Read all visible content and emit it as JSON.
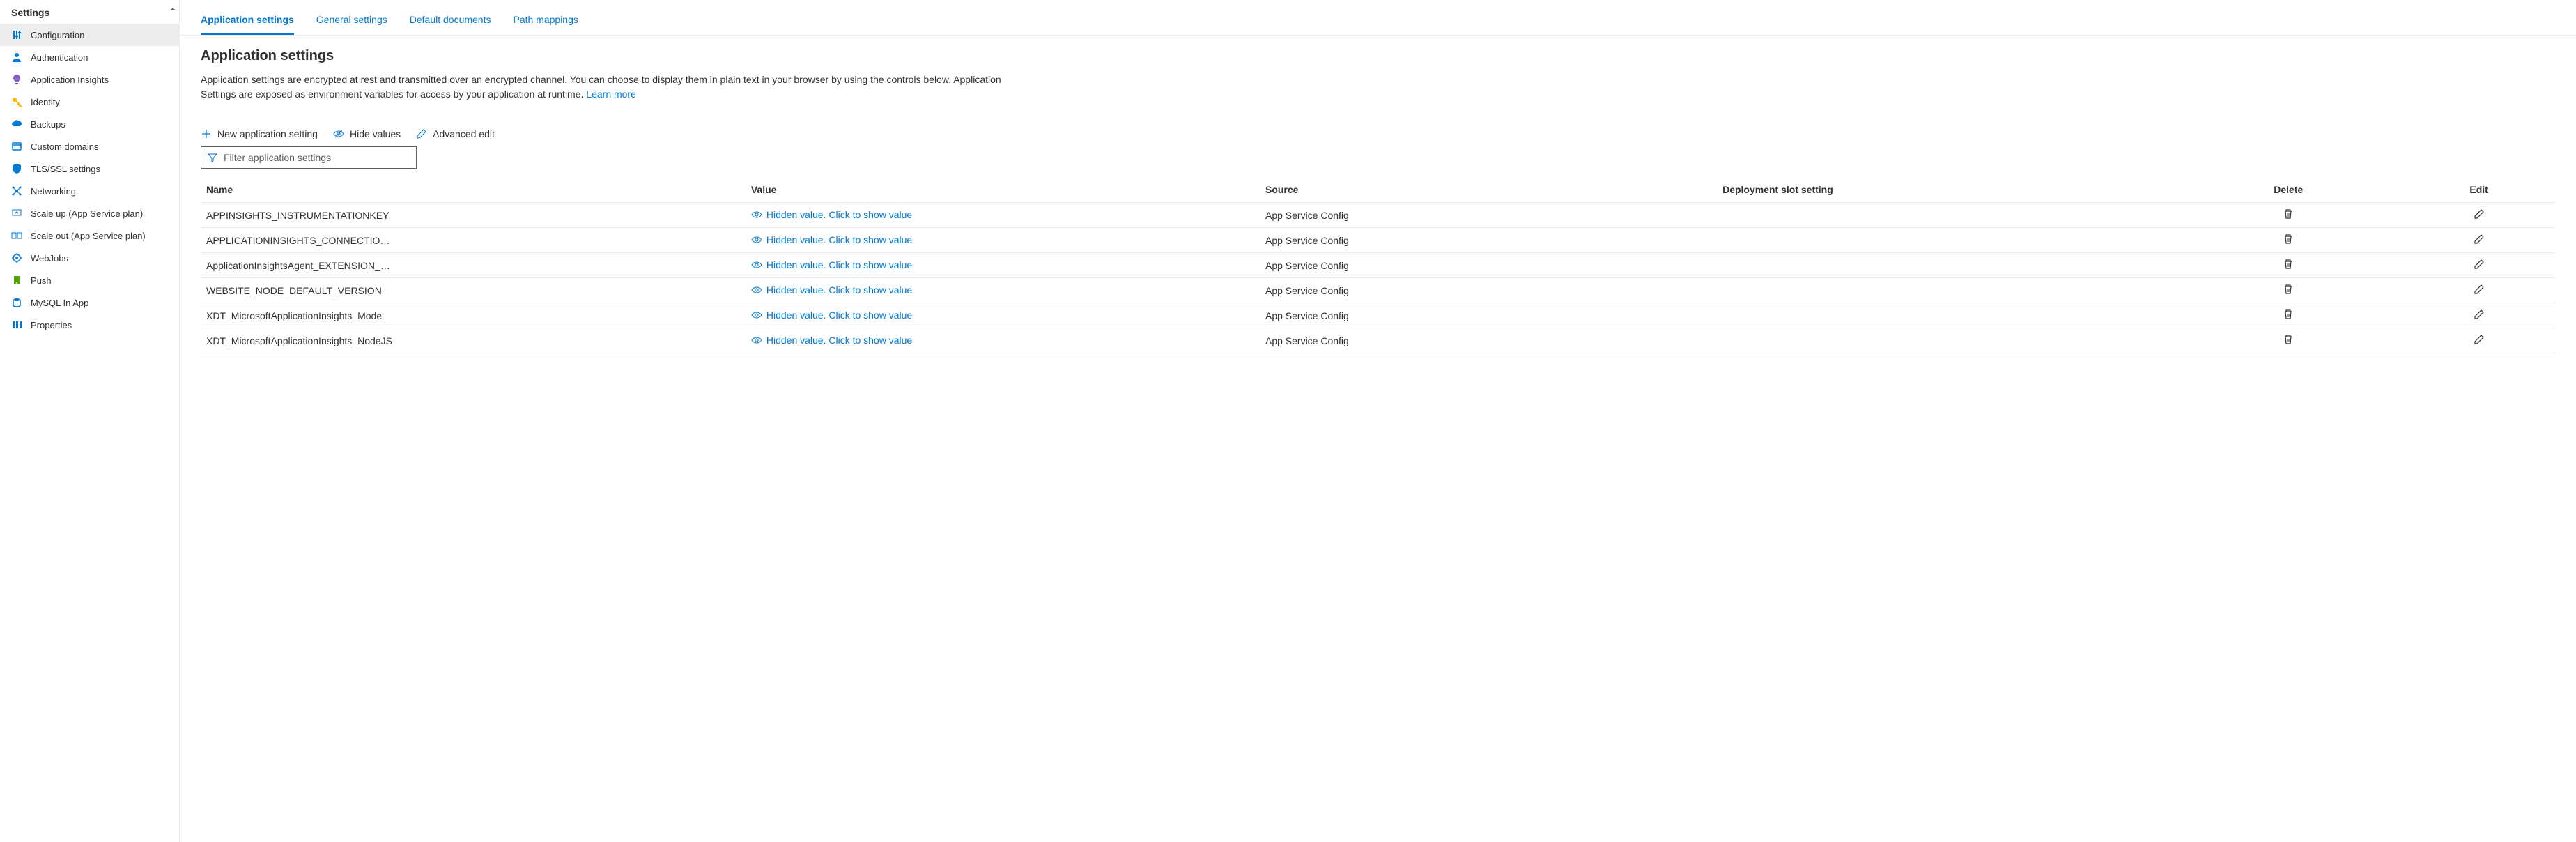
{
  "sidebar": {
    "header": "Settings",
    "items": [
      {
        "label": "Configuration",
        "icon": "sliders",
        "color": "#0078d4",
        "active": true
      },
      {
        "label": "Authentication",
        "icon": "user",
        "color": "#0078d4",
        "active": false
      },
      {
        "label": "Application Insights",
        "icon": "bulb",
        "color": "#8661c5",
        "active": false
      },
      {
        "label": "Identity",
        "icon": "key",
        "color": "#ffb900",
        "active": false
      },
      {
        "label": "Backups",
        "icon": "cloud",
        "color": "#0078d4",
        "active": false
      },
      {
        "label": "Custom domains",
        "icon": "domain",
        "color": "#0078d4",
        "active": false
      },
      {
        "label": "TLS/SSL settings",
        "icon": "shield",
        "color": "#0078d4",
        "active": false
      },
      {
        "label": "Networking",
        "icon": "network",
        "color": "#0078d4",
        "active": false
      },
      {
        "label": "Scale up (App Service plan)",
        "icon": "scaleup",
        "color": "#0078d4",
        "active": false
      },
      {
        "label": "Scale out (App Service plan)",
        "icon": "scaleout",
        "color": "#0078d4",
        "active": false
      },
      {
        "label": "WebJobs",
        "icon": "webjobs",
        "color": "#0078d4",
        "active": false
      },
      {
        "label": "Push",
        "icon": "push",
        "color": "#57a300",
        "active": false
      },
      {
        "label": "MySQL In App",
        "icon": "mysql",
        "color": "#0078d4",
        "active": false
      },
      {
        "label": "Properties",
        "icon": "properties",
        "color": "#0078d4",
        "active": false
      }
    ]
  },
  "tabs": [
    {
      "label": "Application settings",
      "active": true
    },
    {
      "label": "General settings",
      "active": false
    },
    {
      "label": "Default documents",
      "active": false
    },
    {
      "label": "Path mappings",
      "active": false
    }
  ],
  "section": {
    "title": "Application settings",
    "desc_before": "Application settings are encrypted at rest and transmitted over an encrypted channel. You can choose to display them in plain text in your browser by using the controls below. Application Settings are exposed as environment variables for access by your application at runtime. ",
    "learn_more": "Learn more"
  },
  "toolbar": {
    "new_label": "New application setting",
    "hide_label": "Hide values",
    "advanced_label": "Advanced edit"
  },
  "filter": {
    "placeholder": "Filter application settings"
  },
  "table": {
    "headers": {
      "name": "Name",
      "value": "Value",
      "source": "Source",
      "slot": "Deployment slot setting",
      "delete": "Delete",
      "edit": "Edit"
    },
    "hidden_text": "Hidden value. Click to show value",
    "rows": [
      {
        "name": "APPINSIGHTS_INSTRUMENTATIONKEY",
        "source": "App Service Config",
        "slot": ""
      },
      {
        "name": "APPLICATIONINSIGHTS_CONNECTION_STRING",
        "source": "App Service Config",
        "slot": ""
      },
      {
        "name": "ApplicationInsightsAgent_EXTENSION_VERSION",
        "source": "App Service Config",
        "slot": ""
      },
      {
        "name": "WEBSITE_NODE_DEFAULT_VERSION",
        "source": "App Service Config",
        "slot": ""
      },
      {
        "name": "XDT_MicrosoftApplicationInsights_Mode",
        "source": "App Service Config",
        "slot": ""
      },
      {
        "name": "XDT_MicrosoftApplicationInsights_NodeJS",
        "source": "App Service Config",
        "slot": ""
      }
    ]
  }
}
